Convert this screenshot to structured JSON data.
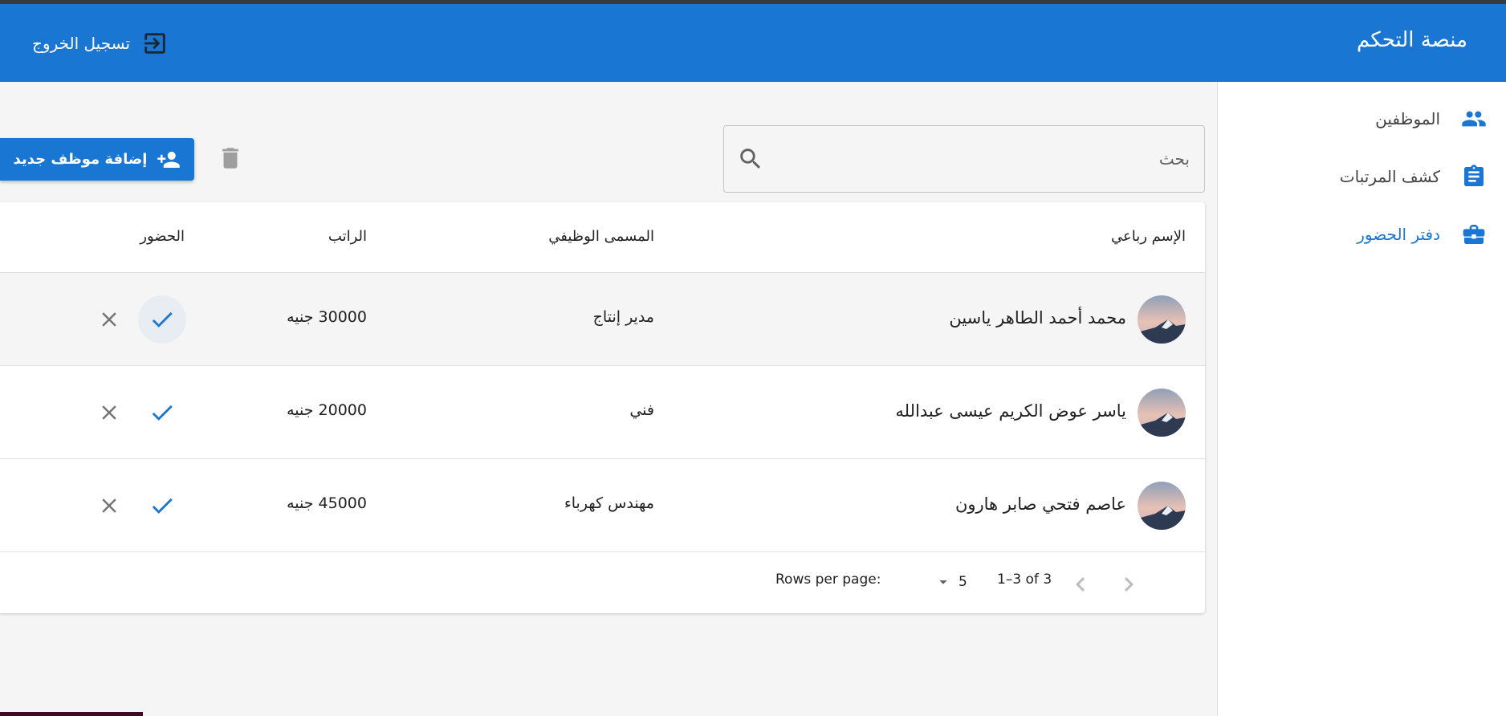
{
  "header": {
    "title": "منصة التحكم",
    "logout_label": "تسجيل الخروج"
  },
  "sidebar": {
    "items": [
      {
        "label": "الموظفين",
        "icon": "people-icon",
        "active": false
      },
      {
        "label": "كشف المرتبات",
        "icon": "clipboard-icon",
        "active": false
      },
      {
        "label": "دفتر الحضور",
        "icon": "briefcase-icon",
        "active": true
      }
    ]
  },
  "toolbar": {
    "search_placeholder": "بحث",
    "add_label": "إضافة موظف جديد"
  },
  "table": {
    "columns": {
      "name": "الإسم رباعي",
      "job": "المسمى الوظيفي",
      "salary": "الراتب",
      "attendance": "الحضور"
    },
    "rows": [
      {
        "name": "محمد أحمد الطاهر ياسين",
        "job": "مدير إنتاج",
        "salary": "30000 جنيه"
      },
      {
        "name": "ياسر عوض الكريم عيسى عبدالله",
        "job": "فني",
        "salary": "20000 جنيه"
      },
      {
        "name": "عاصم فتحي صابر هارون",
        "job": "مهندس كهرباء",
        "salary": "45000 جنيه"
      }
    ]
  },
  "pagination": {
    "rows_per_page_label": "Rows per page:",
    "rows_per_page": "5",
    "range": "1–3 of 3"
  },
  "colors": {
    "primary": "#1976d2",
    "background": "#f5f5f5"
  }
}
